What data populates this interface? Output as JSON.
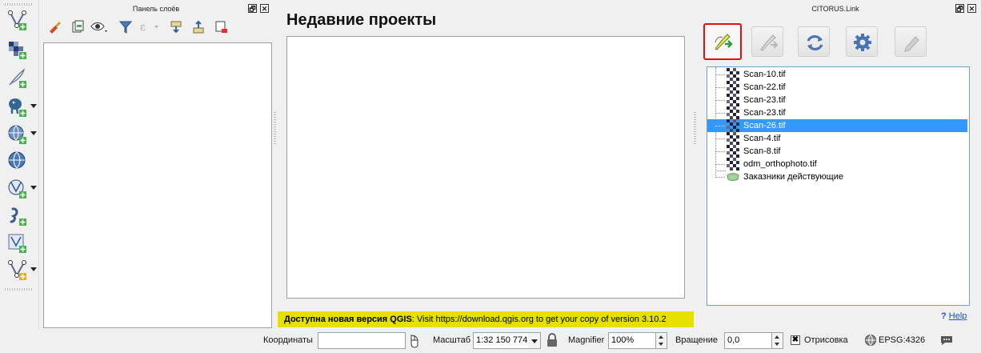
{
  "layers_panel": {
    "title": "Панель слоёв"
  },
  "window_controls": {
    "float_glyph": "🗗",
    "close_glyph": "✕"
  },
  "left_toolbar": {
    "tools": [
      {
        "name": "new-vector-layer-icon"
      },
      {
        "name": "add-raster-layer-icon"
      },
      {
        "name": "add-delimited-text-icon"
      },
      {
        "name": "add-postgis-layer-icon"
      },
      {
        "name": "add-wms-layer-icon"
      },
      {
        "name": "add-wcs-layer-icon"
      },
      {
        "name": "add-wfs-layer-icon"
      },
      {
        "name": "add-spatialite-layer-icon"
      },
      {
        "name": "add-virtual-layer-icon"
      },
      {
        "name": "new-temporary-layer-icon"
      }
    ]
  },
  "recent_projects": {
    "title": "Недавние проекты"
  },
  "update_banner": {
    "bold_text": "Доступна новая версия QGIS",
    "text": ": Visit https://download.qgis.org to get your copy of version 3.10.2"
  },
  "citorus": {
    "title": "CITORUS.Link",
    "buttons": [
      {
        "name": "link-layer-icon",
        "state": "active"
      },
      {
        "name": "unlink-layer-icon",
        "state": "disabled"
      },
      {
        "name": "refresh-icon",
        "state": "enabled"
      },
      {
        "name": "settings-gear-icon",
        "state": "enabled"
      },
      {
        "name": "edit-pencil-icon",
        "state": "disabled"
      }
    ],
    "tree": [
      {
        "label": "Scan-10.tif",
        "type": "raster",
        "selected": false
      },
      {
        "label": "Scan-22.tif",
        "type": "raster",
        "selected": false
      },
      {
        "label": "Scan-23.tif",
        "type": "raster",
        "selected": false
      },
      {
        "label": "Scan-23.tif",
        "type": "raster",
        "selected": false
      },
      {
        "label": "Scan-26.tif",
        "type": "raster",
        "selected": true
      },
      {
        "label": "Scan-4.tif",
        "type": "raster",
        "selected": false
      },
      {
        "label": "Scan-8.tif",
        "type": "raster",
        "selected": false
      },
      {
        "label": "odm_orthophoto.tif",
        "type": "raster",
        "selected": false
      },
      {
        "label": "Заказники действующие",
        "type": "polygon",
        "selected": false
      }
    ],
    "help": {
      "q": "?",
      "label": "Help"
    }
  },
  "statusbar": {
    "coordinates_label": "Координаты",
    "coordinates_value": "",
    "scale_label": "Масштаб",
    "scale_value": "1:32 150 774",
    "magnifier_label": "Magnifier",
    "magnifier_value": "100%",
    "rotation_label": "Вращение",
    "rotation_value": "0,0",
    "render_checked": true,
    "render_check_glyph": "✖",
    "render_label": "Отрисовка",
    "crs_label": "EPSG:4326"
  },
  "colors": {
    "accent_highlight": "#e01010",
    "selection": "#3399ff",
    "banner": "#e5e000"
  }
}
